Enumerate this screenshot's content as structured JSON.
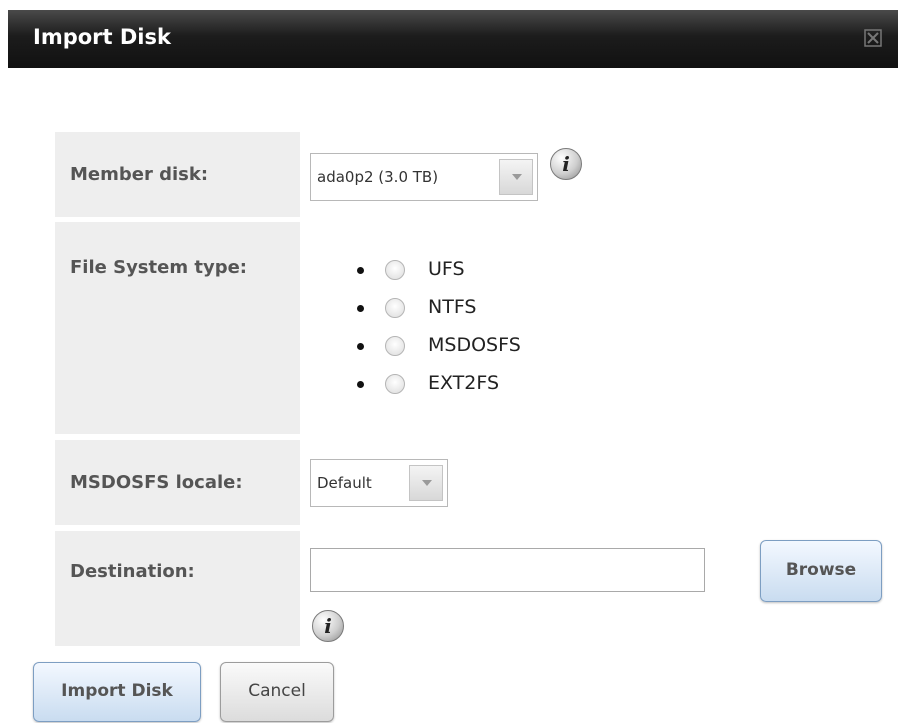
{
  "dialog": {
    "title": "Import Disk",
    "close_icon": "close-icon"
  },
  "form": {
    "member_disk": {
      "label": "Member disk:",
      "selected": "ada0p2 (3.0 TB)",
      "help_icon": "info-icon"
    },
    "fs_type": {
      "label": "File System type:",
      "options": [
        "UFS",
        "NTFS",
        "MSDOSFS",
        "EXT2FS"
      ],
      "selected": null
    },
    "msdosfs_locale": {
      "label": "MSDOSFS locale:",
      "selected": "Default"
    },
    "destination": {
      "label": "Destination:",
      "value": "",
      "browse_label": "Browse",
      "help_icon": "info-icon"
    }
  },
  "actions": {
    "import_label": "Import Disk",
    "cancel_label": "Cancel"
  },
  "colors": {
    "titlebar": "#1c1c1c",
    "label_bg": "#eeeeee",
    "primary_button": "#c9dcf0"
  }
}
